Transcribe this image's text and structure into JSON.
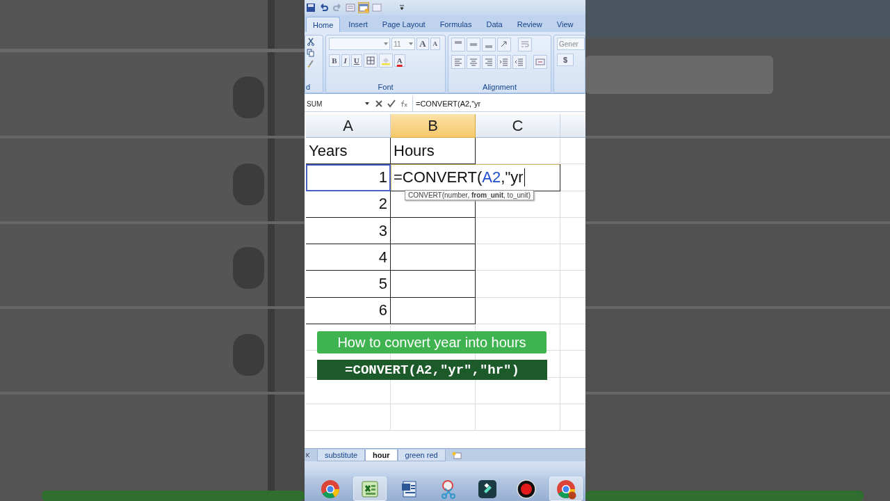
{
  "ribbon_tabs": [
    {
      "label": "Home",
      "selected": true
    },
    {
      "label": "Insert",
      "selected": false
    },
    {
      "label": "Page Layout",
      "selected": false
    },
    {
      "label": "Formulas",
      "selected": false
    },
    {
      "label": "Data",
      "selected": false
    },
    {
      "label": "Review",
      "selected": false
    },
    {
      "label": "View",
      "selected": false
    }
  ],
  "ribbon": {
    "font_size": "11",
    "style_buttons": [
      "B",
      "I",
      "U"
    ],
    "grow_font": "A",
    "shrink_font": "A",
    "font_color": "A",
    "number_format": "Gener",
    "currency": "$",
    "groups": [
      "d",
      "Font",
      "Alignment"
    ]
  },
  "formula_bar": {
    "name_box": "SUM",
    "formula": "=CONVERT(A2,\"yr"
  },
  "sheet": {
    "columns": [
      {
        "label": "A",
        "selected": false
      },
      {
        "label": "B",
        "selected": true
      },
      {
        "label": "C",
        "selected": false
      }
    ],
    "rows": [
      {
        "a": "Years",
        "b": "Hours",
        "kind": "text",
        "referenced": false
      },
      {
        "a": "1",
        "kind": "editing",
        "referenced": true,
        "edit_parts": [
          {
            "text": "=CONVERT(",
            "kind": "plain"
          },
          {
            "text": "A2",
            "kind": "ref"
          },
          {
            "text": ",\"yr",
            "kind": "plain"
          }
        ],
        "tooltip": "CONVERT(number, **from_unit**, to_unit)"
      },
      {
        "a": "2",
        "kind": "number",
        "referenced": false
      },
      {
        "a": "3",
        "kind": "number",
        "referenced": false
      },
      {
        "a": "4",
        "kind": "number",
        "referenced": false
      },
      {
        "a": "5",
        "kind": "number",
        "referenced": false
      },
      {
        "a": "6",
        "kind": "number",
        "referenced": false
      }
    ]
  },
  "caption": "How to convert year into hours",
  "formula_banner": "=CONVERT(A2,\"yr\",\"hr\")",
  "sheet_tabs": [
    {
      "label": "substitute",
      "selected": false
    },
    {
      "label": "hour",
      "selected": true
    },
    {
      "label": "green red",
      "selected": false
    }
  ],
  "taskbar": [
    {
      "kind": "chrome",
      "active": false
    },
    {
      "kind": "excel",
      "active": true
    },
    {
      "kind": "word",
      "active": false
    },
    {
      "kind": "scissors",
      "active": false
    },
    {
      "kind": "editor",
      "active": false
    },
    {
      "kind": "record",
      "active": false
    },
    {
      "kind": "chrome-profile",
      "active": true
    }
  ]
}
